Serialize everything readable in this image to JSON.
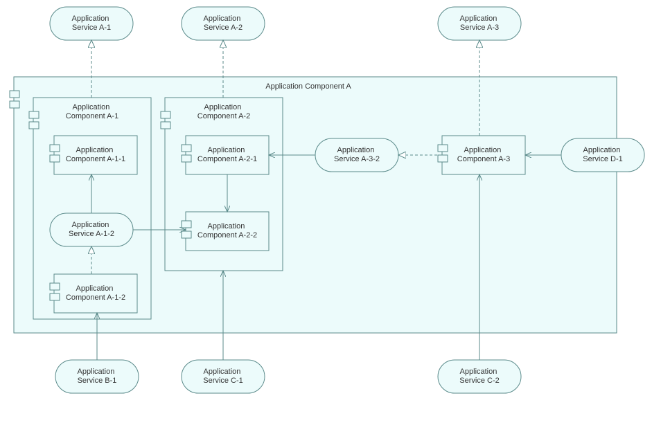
{
  "nodes": {
    "svc_a1": "Application\nService A-1",
    "svc_a2": "Application\nService A-2",
    "svc_a3": "Application\nService A-3",
    "svc_d1": "Application\nService D-1",
    "svc_b1": "Application\nService B-1",
    "svc_c1": "Application\nService C-1",
    "svc_c2": "Application\nService C-2",
    "svc_a12": "Application\nService A-1-2",
    "svc_a32": "Application\nService A-3-2",
    "comp_a": "Application Component A",
    "comp_a1": "Application\nComponent A-1",
    "comp_a2": "Application\nComponent A-2",
    "comp_a3": "Application\nComponent A-3",
    "comp_a11": "Application\nComponent A-1-1",
    "comp_a1b": "Application\nComponent A-1-2",
    "comp_a21": "Application\nComponent A-2-1",
    "comp_a22": "Application\nComponent A-2-2"
  }
}
